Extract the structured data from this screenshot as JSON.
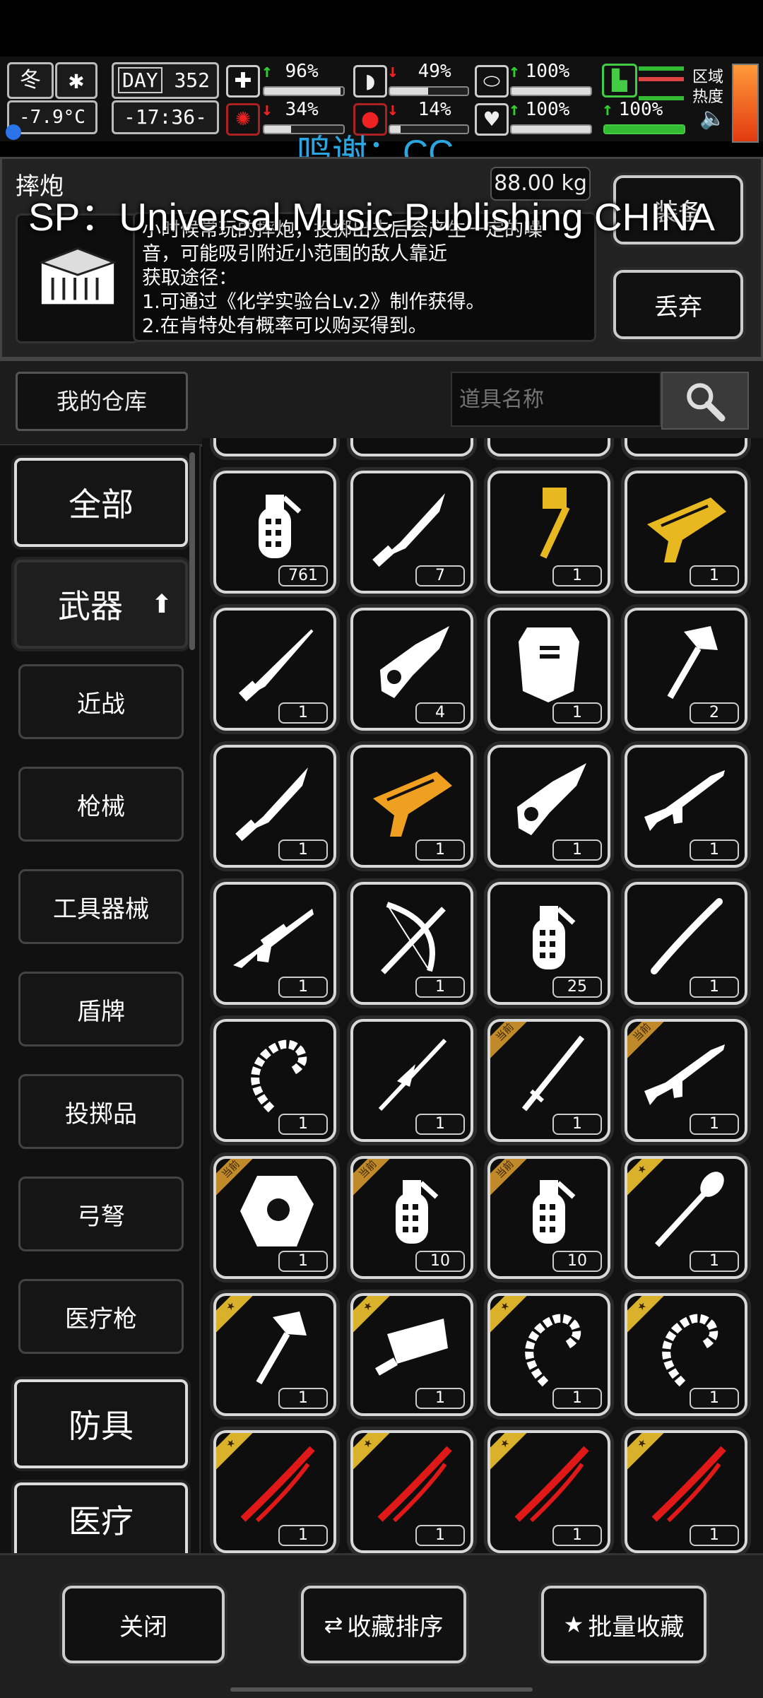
{
  "hud": {
    "season": "冬",
    "temperature": "-7.9°C",
    "day_label": "DAY",
    "day": "352",
    "clock": "-17:36-",
    "stats": [
      {
        "name": "medkit-icon",
        "value": "96%",
        "dir": "up",
        "level": 0.96
      },
      {
        "name": "stomach-icon",
        "value": "49%",
        "dir": "down",
        "level": 0.49
      },
      {
        "name": "pill-icon",
        "value": "100%",
        "dir": "up",
        "level": 1.0
      },
      {
        "name": "stamina-boot-icon",
        "value": "",
        "dir": "none",
        "level": 1.0
      },
      {
        "name": "brain-icon",
        "value": "34%",
        "dir": "down",
        "level": 0.34
      },
      {
        "name": "water-drop-icon",
        "value": "14%",
        "dir": "down",
        "level": 0.14
      },
      {
        "name": "heart-icon",
        "value": "100%",
        "dir": "up",
        "level": 1.0
      },
      {
        "name": "boot-icon",
        "value": "100%",
        "dir": "up",
        "level": 1.0
      }
    ],
    "zone_heat": "区域\n热度",
    "zone_line1": "区域",
    "zone_line2": "热度"
  },
  "overlay": {
    "thanks": "鸣谢：CC",
    "sponsor": "SP：Universal Music Publishing CHINA"
  },
  "item_detail": {
    "name": "摔炮",
    "weight": "88.00 kg",
    "desc_lines": [
      "小时候常玩的摔炮，投掷出去后会产生一定的噪",
      "音，可能吸引附近小范围的敌人靠近",
      "获取途径：",
      "1.可通过《化学实验台Lv.2》制作获得。",
      "2.在肯特处有概率可以购买得到。"
    ],
    "action_label": "装备",
    "discard_label": "丢弃"
  },
  "storage": {
    "title": "我的仓库",
    "search_placeholder": "道具名称"
  },
  "categories": {
    "all": "全部",
    "weapons": "武器",
    "subs": [
      "近战",
      "枪械",
      "工具器械",
      "盾牌",
      "投掷品",
      "弓弩",
      "医疗枪"
    ],
    "armor": "防具",
    "medical": "医疗"
  },
  "grid_items": [
    {
      "icon": "grenade-icon",
      "count": "761",
      "badge": "",
      "color": "#fff"
    },
    {
      "icon": "knife-icon",
      "count": "7",
      "badge": "",
      "color": "#fff"
    },
    {
      "icon": "hammer-icon",
      "count": "1",
      "badge": "",
      "color": "#e8b820"
    },
    {
      "icon": "blaster-icon",
      "count": "1",
      "badge": "",
      "color": "#e8b820"
    },
    {
      "icon": "dagger-icon",
      "count": "1",
      "badge": "",
      "color": "#fff"
    },
    {
      "icon": "chainsaw-icon",
      "count": "4",
      "badge": "",
      "color": "#fff"
    },
    {
      "icon": "riot-shield-icon",
      "count": "1",
      "badge": "",
      "color": "#fff"
    },
    {
      "icon": "axe-icon",
      "count": "2",
      "badge": "",
      "color": "#fff"
    },
    {
      "icon": "knife-icon",
      "count": "1",
      "badge": "",
      "color": "#fff"
    },
    {
      "icon": "blaster-icon",
      "count": "1",
      "badge": "",
      "color": "#f0a020"
    },
    {
      "icon": "chainsaw-icon",
      "count": "1",
      "badge": "",
      "color": "#fff"
    },
    {
      "icon": "rifle-icon",
      "count": "1",
      "badge": "",
      "color": "#fff"
    },
    {
      "icon": "sniper-rifle-icon",
      "count": "1",
      "badge": "",
      "color": "#fff"
    },
    {
      "icon": "crossbow-icon",
      "count": "1",
      "badge": "",
      "color": "#fff"
    },
    {
      "icon": "grenade-icon",
      "count": "25",
      "badge": "",
      "color": "#fff"
    },
    {
      "icon": "staff-icon",
      "count": "1",
      "badge": "",
      "color": "#fff"
    },
    {
      "icon": "whip-icon",
      "count": "1",
      "badge": "",
      "color": "#fff"
    },
    {
      "icon": "spear-icon",
      "count": "1",
      "badge": "",
      "color": "#fff"
    },
    {
      "icon": "katana-icon",
      "count": "1",
      "badge": "当前",
      "color": "#fff"
    },
    {
      "icon": "rifle-icon",
      "count": "1",
      "badge": "当前",
      "color": "#fff"
    },
    {
      "icon": "armor-plate-icon",
      "count": "1",
      "badge": "当前",
      "color": "#fff"
    },
    {
      "icon": "grenade-icon",
      "count": "10",
      "badge": "当前",
      "color": "#fff"
    },
    {
      "icon": "grenade-icon",
      "count": "10",
      "badge": "当前",
      "color": "#fff"
    },
    {
      "icon": "shovel-icon",
      "count": "1",
      "badge": "star",
      "color": "#fff"
    },
    {
      "icon": "axe-icon",
      "count": "1",
      "badge": "star",
      "color": "#fff"
    },
    {
      "icon": "cleaver-icon",
      "count": "1",
      "badge": "star",
      "color": "#fff"
    },
    {
      "icon": "whip-icon",
      "count": "1",
      "badge": "star",
      "color": "#fff"
    },
    {
      "icon": "whip-icon",
      "count": "1",
      "badge": "star",
      "color": "#fff"
    },
    {
      "icon": "red-blade-icon",
      "count": "1",
      "badge": "star",
      "color": "#e01818"
    },
    {
      "icon": "red-blade-icon",
      "count": "1",
      "badge": "star",
      "color": "#e01818"
    },
    {
      "icon": "red-blade-icon",
      "count": "1",
      "badge": "star",
      "color": "#e01818"
    },
    {
      "icon": "red-blade-icon",
      "count": "1",
      "badge": "star",
      "color": "#e01818"
    }
  ],
  "footer": {
    "close": "关闭",
    "sort": "收藏排序",
    "batch": "批量收藏"
  },
  "colors": {
    "accent_overlay": "#2aa7e0",
    "badge_current": "#c08a2a",
    "badge_star": "#d9b12a"
  }
}
